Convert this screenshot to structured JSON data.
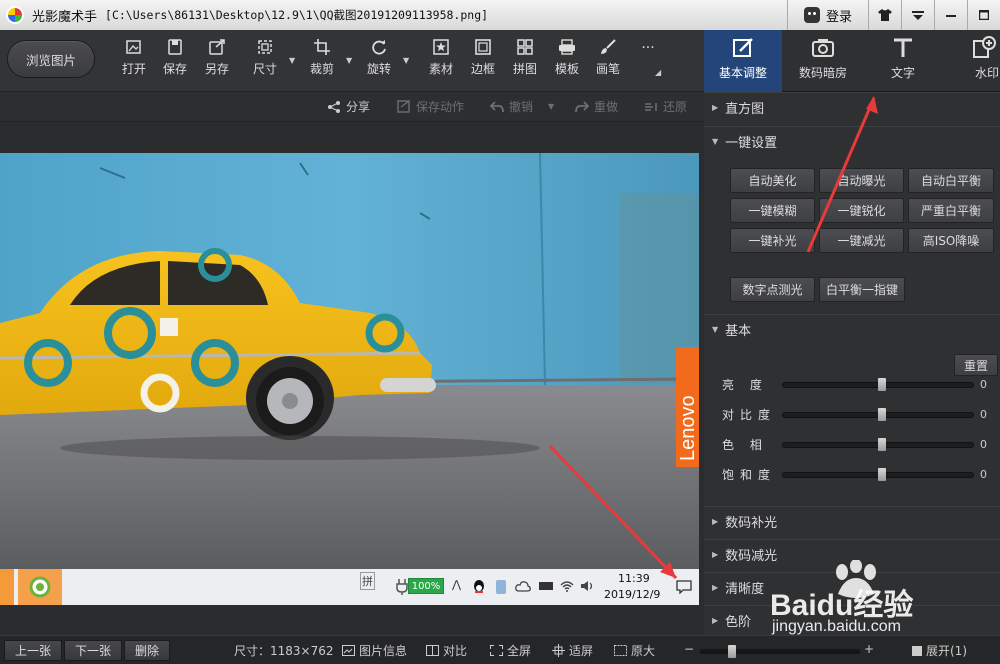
{
  "app": {
    "name": "光影魔术手",
    "path": "[C:\\Users\\86131\\Desktop\\12.9\\1\\QQ截图20191209113958.png]",
    "login_label": "登录"
  },
  "toolbar": {
    "browse_label": "浏览图片",
    "tools": [
      {
        "label": "打开",
        "icon": "open-icon"
      },
      {
        "label": "保存",
        "icon": "save-icon"
      },
      {
        "label": "另存",
        "icon": "save-as-icon"
      },
      {
        "label": "尺寸",
        "icon": "resize-icon"
      },
      {
        "label": "裁剪",
        "icon": "crop-icon"
      },
      {
        "label": "旋转",
        "icon": "rotate-icon"
      },
      {
        "label": "素材",
        "icon": "material-icon"
      },
      {
        "label": "边框",
        "icon": "border-icon"
      },
      {
        "label": "拼图",
        "icon": "collage-icon"
      },
      {
        "label": "模板",
        "icon": "template-icon"
      },
      {
        "label": "画笔",
        "icon": "brush-icon"
      }
    ],
    "more_label": "···"
  },
  "right_tabs": [
    {
      "label": "基本调整",
      "icon": "basic-adjust-icon",
      "active": true
    },
    {
      "label": "数码暗房",
      "icon": "darkroom-icon",
      "active": false
    },
    {
      "label": "文字",
      "icon": "text-icon",
      "active": false
    },
    {
      "label": "水印",
      "icon": "watermark-icon",
      "active": false
    }
  ],
  "actions": {
    "share": "分享",
    "save_action": "保存动作",
    "undo": "撤销",
    "redo": "重做",
    "restore": "还原"
  },
  "panel": {
    "histogram": "直方图",
    "oneclick": "一键设置",
    "oneclick_buttons": [
      "自动美化",
      "自动曝光",
      "自动白平衡",
      "一键模糊",
      "一键锐化",
      "严重白平衡",
      "一键补光",
      "一键减光",
      "高ISO降噪"
    ],
    "extra_buttons": [
      "数字点测光",
      "白平衡一指键"
    ],
    "basic": "基本",
    "reset": "重置",
    "sliders": [
      {
        "label": "亮 度",
        "value": "0",
        "level": 0.5
      },
      {
        "label": "对比度",
        "value": "0",
        "level": 0.5
      },
      {
        "label": "色 相",
        "value": "0",
        "level": 0.5
      },
      {
        "label": "饱和度",
        "value": "0",
        "level": 0.5
      }
    ],
    "sections_bottom": [
      "数码补光",
      "数码减光",
      "清晰度",
      "色阶"
    ]
  },
  "photo": {
    "brand": "Lenovo",
    "taskbar": {
      "ime": "拼",
      "battery": "100%",
      "time": "11:39",
      "date": "2019/12/9"
    }
  },
  "status": {
    "prev": "上一张",
    "next": "下一张",
    "delete": "删除",
    "size": "尺寸：1183×762",
    "info": "图片信息",
    "compare": "对比",
    "fullscreen": "全屏",
    "fit": "适屏",
    "original": "原大",
    "expand": "展开(1)"
  },
  "watermark": {
    "text": "Baidu经验",
    "url": "jingyan.baidu.com"
  },
  "colors": {
    "accent_tab": "#23457a",
    "annotation_arrow": "#e83a3a"
  }
}
